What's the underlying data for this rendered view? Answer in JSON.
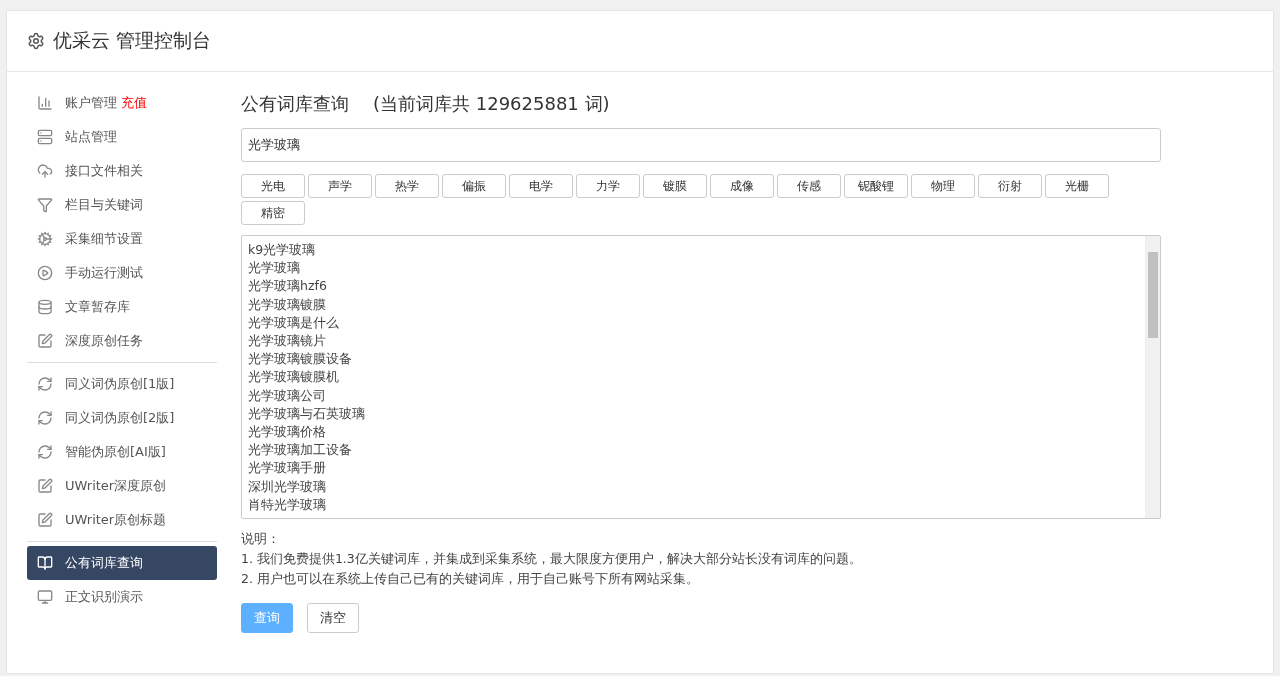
{
  "header": {
    "title": "优采云 管理控制台"
  },
  "sidebar": {
    "sections": [
      [
        {
          "label": "账户管理",
          "badge": "充值",
          "selected": false
        },
        {
          "label": "站点管理",
          "selected": false
        },
        {
          "label": "接口文件相关",
          "selected": false
        },
        {
          "label": "栏目与关键词",
          "selected": false
        },
        {
          "label": "采集细节设置",
          "selected": false
        },
        {
          "label": "手动运行测试",
          "selected": false
        },
        {
          "label": "文章暂存库",
          "selected": false
        },
        {
          "label": "深度原创任务",
          "selected": false
        }
      ],
      [
        {
          "label": "同义词伪原创[1版]",
          "selected": false
        },
        {
          "label": "同义词伪原创[2版]",
          "selected": false
        },
        {
          "label": "智能伪原创[AI版]",
          "selected": false
        },
        {
          "label": "UWriter深度原创",
          "selected": false
        },
        {
          "label": "UWriter原创标题",
          "selected": false
        }
      ],
      [
        {
          "label": "公有词库查询",
          "selected": true
        },
        {
          "label": "正文识别演示",
          "selected": false
        }
      ]
    ]
  },
  "main": {
    "title": "公有词库查询",
    "subtitle": "(当前词库共 129625881 词)",
    "search": {
      "value": "光学玻璃"
    },
    "tags": [
      "光电",
      "声学",
      "热学",
      "偏振",
      "电学",
      "力学",
      "镀膜",
      "成像",
      "传感",
      "铌酸锂",
      "物理",
      "衍射",
      "光栅",
      "精密"
    ],
    "results": [
      "k9光学玻璃",
      "光学玻璃",
      "光学玻璃hzf6",
      "光学玻璃镀膜",
      "光学玻璃是什么",
      "光学玻璃镜片",
      "光学玻璃镀膜设备",
      "光学玻璃镀膜机",
      "光学玻璃公司",
      "光学玻璃与石英玻璃",
      "光学玻璃价格",
      "光学玻璃加工设备",
      "光学玻璃手册",
      "深圳光学玻璃",
      "肖特光学玻璃"
    ],
    "notes_title": "说明：",
    "notes": [
      "1. 我们免费提供1.3亿关键词库，并集成到采集系统，最大限度方便用户，解决大部分站长没有词库的问题。",
      "2. 用户也可以在系统上传自己已有的关键词库，用于自己账号下所有网站采集。"
    ],
    "buttons": [
      {
        "label": "查询",
        "kind": "primary"
      },
      {
        "label": "清空",
        "kind": "default"
      }
    ]
  }
}
